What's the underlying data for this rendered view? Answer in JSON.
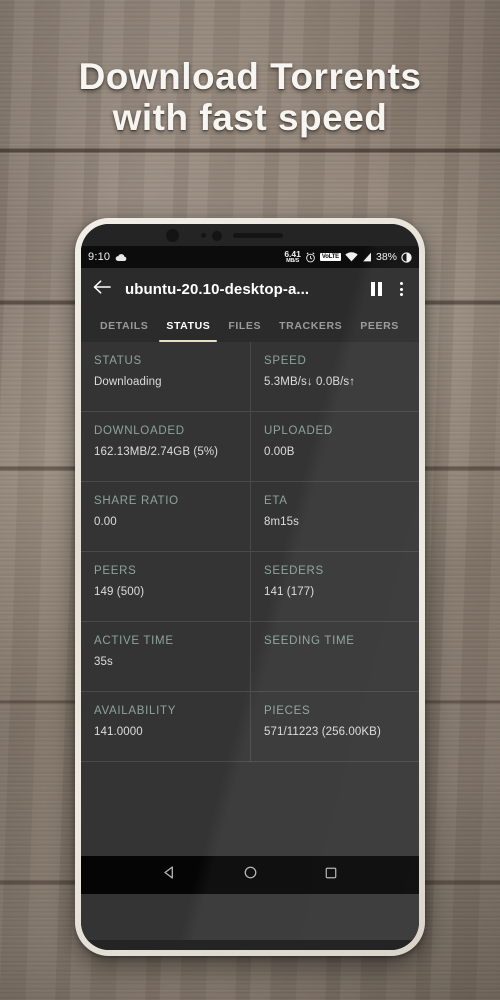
{
  "promo": {
    "headline_line1": "Download Torrents",
    "headline_line2": "with fast speed"
  },
  "status_bar": {
    "time": "9:10",
    "cloud_icon": "cloud-upload-icon",
    "data_rate_value": "6.41",
    "data_rate_unit": "MB/S",
    "alarm_icon": "alarm-clock-icon",
    "volte_label": "VoLTE",
    "wifi_icon": "wifi-icon",
    "signal_icon": "cellular-signal-icon",
    "battery_percent": "38%",
    "battery_icon": "battery-circle-icon"
  },
  "toolbar": {
    "back_icon": "back-arrow-icon",
    "title": "ubuntu-20.10-desktop-a...",
    "pause_icon": "pause-icon",
    "overflow_icon": "overflow-menu-icon"
  },
  "tabs": {
    "items": [
      {
        "label": "DETAILS",
        "active": false
      },
      {
        "label": "STATUS",
        "active": true
      },
      {
        "label": "FILES",
        "active": false
      },
      {
        "label": "TRACKERS",
        "active": false
      },
      {
        "label": "PEERS",
        "active": false
      }
    ],
    "indicator_color": "#e6dfc2"
  },
  "status_grid": {
    "label_color": "#8ea39d",
    "value_color": "#dcdcdc",
    "rows": [
      [
        {
          "label": "STATUS",
          "value": "Downloading"
        },
        {
          "label": "SPEED",
          "value": "5.3MB/s↓ 0.0B/s↑"
        }
      ],
      [
        {
          "label": "DOWNLOADED",
          "value": "162.13MB/2.74GB (5%)"
        },
        {
          "label": "UPLOADED",
          "value": "0.00B"
        }
      ],
      [
        {
          "label": "SHARE RATIO",
          "value": "0.00"
        },
        {
          "label": "ETA",
          "value": "8m15s"
        }
      ],
      [
        {
          "label": "PEERS",
          "value": "149 (500)"
        },
        {
          "label": "SEEDERS",
          "value": "141 (177)"
        }
      ],
      [
        {
          "label": "ACTIVE TIME",
          "value": "35s"
        },
        {
          "label": "SEEDING TIME",
          "value": ""
        }
      ],
      [
        {
          "label": "AVAILABILITY",
          "value": "141.0000"
        },
        {
          "label": "PIECES",
          "value": "571/11223 (256.00KB)"
        }
      ]
    ]
  },
  "nav_bar": {
    "back_icon": "nav-back-triangle-icon",
    "home_icon": "nav-home-circle-icon",
    "recents_icon": "nav-recents-square-icon"
  }
}
